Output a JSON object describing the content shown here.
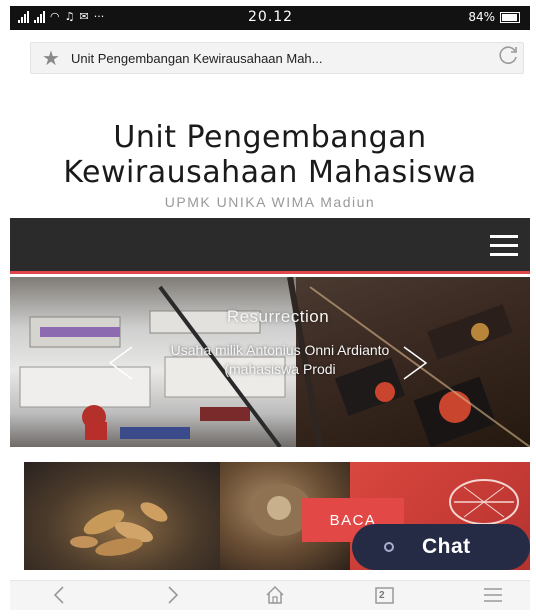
{
  "status_bar": {
    "network_label": "ılıı",
    "time": "20.12",
    "battery": "84%"
  },
  "address_bar": {
    "url_text": "Unit Pengembangan Kewirausahaan Mah..."
  },
  "site_header": {
    "title": "Unit Pengembangan Kewirausahaan Mahasiswa",
    "subtitle": "UPMK UNIKA WIMA Madiun"
  },
  "slider": {
    "title": "Resurrection",
    "caption": "Usaha milik Antonius Onni Ardianto (mahasiswa Prodi"
  },
  "feature": {
    "button_label": "BACA"
  },
  "chat": {
    "label": "Chat"
  },
  "toolbar": {
    "tabs_count": "2"
  },
  "colors": {
    "status_bar": "#121212",
    "navbar": "#2c2b2b",
    "nav_accent": "#e0474b",
    "baca_button": "#e24846",
    "chat_pill": "#262b45"
  },
  "icons": [
    "star-icon",
    "reload-icon",
    "menu-icon",
    "chevron-left-icon",
    "chevron-right-icon",
    "chat-icon",
    "back-icon",
    "forward-icon",
    "home-icon",
    "tabs-icon",
    "overflow-menu-icon"
  ]
}
